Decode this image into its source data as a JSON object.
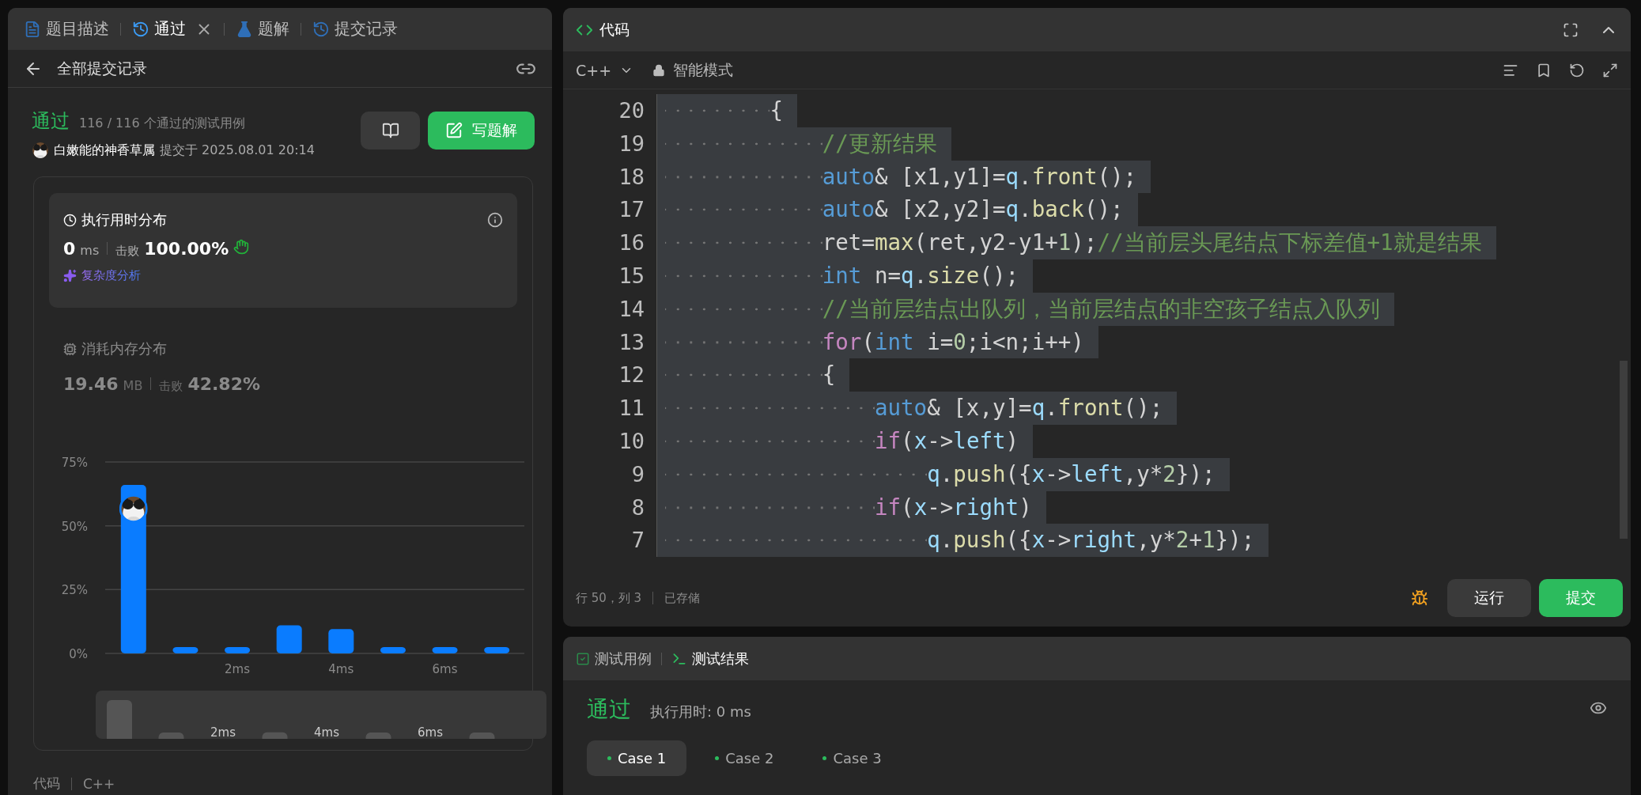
{
  "tabs": [
    {
      "label": "题目描述",
      "kind": "description",
      "selected": false,
      "closable": false
    },
    {
      "label": "通过",
      "kind": "result",
      "selected": true,
      "closable": true
    },
    {
      "label": "题解",
      "kind": "solution",
      "selected": false,
      "closable": false
    },
    {
      "label": "提交记录",
      "kind": "history",
      "selected": false,
      "closable": false
    }
  ],
  "back_link": {
    "label": "全部提交记录"
  },
  "result": {
    "status": "通过",
    "summary": "116 / 116 个通过的测试用例",
    "user": "白嫩能的神香草属",
    "submitted": "提交于 2025.08.01 20:14",
    "write_button": "写题解"
  },
  "runtime": {
    "title": "执行用时分布",
    "value": "0",
    "unit": "ms",
    "beats_label": "击败",
    "beats": "100.00%",
    "analysis": "复杂度分析"
  },
  "memory": {
    "title": "消耗内存分布",
    "value": "19.46",
    "unit": "MB",
    "beats_label": "击败",
    "beats": "42.82%",
    "chart_data": {
      "type": "bar",
      "x": [
        0,
        1,
        2,
        3,
        4,
        5,
        6,
        7
      ],
      "series": [
        {
          "color": "#0a7cff",
          "values": [
            66,
            2.5,
            2.5,
            11,
            9.5,
            2.5,
            2.5,
            2.5
          ]
        }
      ],
      "xlim": [
        -0.5,
        7.5
      ],
      "ylim": [
        0,
        75
      ],
      "yticks": [
        {
          "value": 0,
          "label": "0%"
        },
        {
          "value": 25,
          "label": "25%"
        },
        {
          "value": 50,
          "label": "50%"
        },
        {
          "value": 75,
          "label": "75%"
        }
      ],
      "xticks": [
        {
          "value": 2,
          "label": "2ms"
        },
        {
          "value": 4,
          "label": "4ms"
        },
        {
          "value": 6,
          "label": "6ms"
        }
      ]
    },
    "overview_labels": [
      "2ms",
      "4ms",
      "6ms"
    ]
  },
  "code_summary": {
    "label": "代码",
    "language": "C++"
  },
  "editor": {
    "title": "代码",
    "language": "C++",
    "mode": "智能模式",
    "status": "行 50，列 3",
    "saved": "已存储",
    "run": "运行",
    "submit": "提交",
    "lines": [
      {
        "number": "20",
        "selected": true,
        "tokens": [
          {
            "kind": "plain",
            "text": "{"
          }
        ],
        "children": [
          {
            "number": "19",
            "selected": true,
            "tokens": [
              {
                "kind": "comment",
                "text": "//更新结果"
              }
            ]
          },
          {
            "number": "18",
            "selected": true,
            "tokens": [
              {
                "kind": "type",
                "text": "auto"
              },
              {
                "kind": "plain",
                "text": "& [x1,y1]="
              },
              {
                "kind": "var",
                "text": "q"
              },
              {
                "kind": "plain",
                "text": "."
              },
              {
                "kind": "func",
                "text": "front"
              },
              {
                "kind": "plain",
                "text": "();"
              }
            ]
          },
          {
            "number": "17",
            "selected": true,
            "tokens": [
              {
                "kind": "type",
                "text": "auto"
              },
              {
                "kind": "plain",
                "text": "& [x2,y2]="
              },
              {
                "kind": "var",
                "text": "q"
              },
              {
                "kind": "plain",
                "text": "."
              },
              {
                "kind": "func",
                "text": "back"
              },
              {
                "kind": "plain",
                "text": "();"
              }
            ]
          },
          {
            "number": "16",
            "selected": true,
            "tokens": [
              {
                "kind": "plain",
                "text": "ret="
              },
              {
                "kind": "func",
                "text": "max"
              },
              {
                "kind": "plain",
                "text": "(ret,y2-y1+"
              },
              {
                "kind": "number",
                "text": "1"
              },
              {
                "kind": "plain",
                "text": ");"
              },
              {
                "kind": "comment",
                "text": "//当前层头尾结点下标差值+1就是结果"
              }
            ]
          },
          {
            "number": "15",
            "selected": true,
            "tokens": [
              {
                "kind": "type",
                "text": "int"
              },
              {
                "kind": "plain",
                "text": " n="
              },
              {
                "kind": "var",
                "text": "q"
              },
              {
                "kind": "plain",
                "text": "."
              },
              {
                "kind": "func",
                "text": "size"
              },
              {
                "kind": "plain",
                "text": "();"
              }
            ]
          },
          {
            "number": "14",
            "selected": true,
            "tokens": [
              {
                "kind": "comment",
                "text": "//当前层结点出队列，当前层结点的非空孩子结点入队列"
              }
            ]
          },
          {
            "number": "13",
            "selected": true,
            "tokens": [
              {
                "kind": "control",
                "text": "for"
              },
              {
                "kind": "plain",
                "text": "("
              },
              {
                "kind": "type",
                "text": "int"
              },
              {
                "kind": "plain",
                "text": " i="
              },
              {
                "kind": "number",
                "text": "0"
              },
              {
                "kind": "plain",
                "text": ";i<n;i++)"
              }
            ]
          },
          {
            "number": "12",
            "selected": true,
            "tokens": [
              {
                "kind": "plain",
                "text": "{"
              }
            ],
            "children": [
              {
                "number": "11",
                "selected": true,
                "tokens": [
                  {
                    "kind": "type",
                    "text": "auto"
                  },
                  {
                    "kind": "plain",
                    "text": "& [x,y]="
                  },
                  {
                    "kind": "var",
                    "text": "q"
                  },
                  {
                    "kind": "plain",
                    "text": "."
                  },
                  {
                    "kind": "func",
                    "text": "front"
                  },
                  {
                    "kind": "plain",
                    "text": "();"
                  }
                ]
              },
              {
                "number": "10",
                "selected": true,
                "tokens": [
                  {
                    "kind": "control",
                    "text": "if"
                  },
                  {
                    "kind": "plain",
                    "text": "("
                  },
                  {
                    "kind": "var",
                    "text": "x"
                  },
                  {
                    "kind": "plain",
                    "text": "->"
                  },
                  {
                    "kind": "var",
                    "text": "left"
                  },
                  {
                    "kind": "plain",
                    "text": ")"
                  }
                ],
                "children": [
                  {
                    "number": "9",
                    "selected": true,
                    "tokens": [
                      {
                        "kind": "var",
                        "text": "q"
                      },
                      {
                        "kind": "plain",
                        "text": "."
                      },
                      {
                        "kind": "func",
                        "text": "push"
                      },
                      {
                        "kind": "plain",
                        "text": "({"
                      },
                      {
                        "kind": "var",
                        "text": "x"
                      },
                      {
                        "kind": "plain",
                        "text": "->"
                      },
                      {
                        "kind": "var",
                        "text": "left"
                      },
                      {
                        "kind": "plain",
                        "text": ",y*"
                      },
                      {
                        "kind": "number",
                        "text": "2"
                      },
                      {
                        "kind": "plain",
                        "text": "});"
                      }
                    ]
                  }
                ]
              },
              {
                "number": "8",
                "selected": true,
                "tokens": [
                  {
                    "kind": "control",
                    "text": "if"
                  },
                  {
                    "kind": "plain",
                    "text": "("
                  },
                  {
                    "kind": "var",
                    "text": "x"
                  },
                  {
                    "kind": "plain",
                    "text": "->"
                  },
                  {
                    "kind": "var",
                    "text": "right"
                  },
                  {
                    "kind": "plain",
                    "text": ")"
                  }
                ],
                "children": [
                  {
                    "number": "7",
                    "selected": true,
                    "tokens": [
                      {
                        "kind": "var",
                        "text": "q"
                      },
                      {
                        "kind": "plain",
                        "text": "."
                      },
                      {
                        "kind": "func",
                        "text": "push"
                      },
                      {
                        "kind": "plain",
                        "text": "({"
                      },
                      {
                        "kind": "var",
                        "text": "x"
                      },
                      {
                        "kind": "plain",
                        "text": "->"
                      },
                      {
                        "kind": "var",
                        "text": "right"
                      },
                      {
                        "kind": "plain",
                        "text": ",y*"
                      },
                      {
                        "kind": "number",
                        "text": "2"
                      },
                      {
                        "kind": "plain",
                        "text": "+"
                      },
                      {
                        "kind": "number",
                        "text": "1"
                      },
                      {
                        "kind": "plain",
                        "text": "});"
                      }
                    ]
                  }
                ]
              }
            ]
          }
        ]
      }
    ]
  },
  "console": {
    "tabs": [
      {
        "label": "测试用例",
        "kind": "cases",
        "selected": false
      },
      {
        "label": "测试结果",
        "kind": "result",
        "selected": true
      }
    ],
    "status": "通过",
    "runtime": "执行用时: 0 ms",
    "cases": [
      {
        "label": "Case 1",
        "selected": true
      },
      {
        "label": "Case 2",
        "selected": false
      },
      {
        "label": "Case 3",
        "selected": false
      }
    ]
  }
}
